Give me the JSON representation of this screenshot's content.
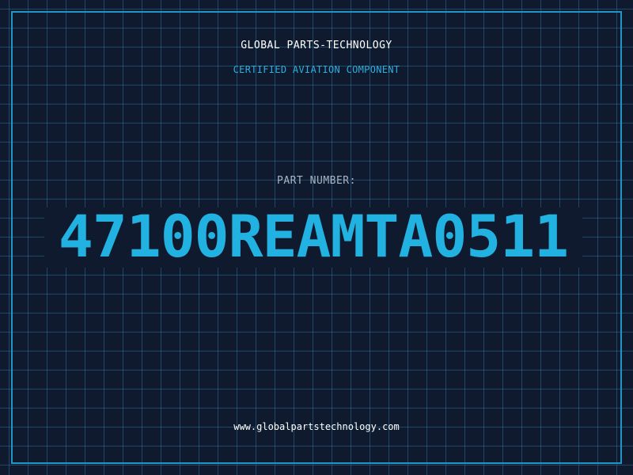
{
  "header": {
    "company": "GLOBAL PARTS-TECHNOLOGY",
    "subtitle": "CERTIFIED AVIATION COMPONENT"
  },
  "part": {
    "label": "PART NUMBER:",
    "number": "47100REAMTA0511"
  },
  "footer": {
    "website": "www.globalpartstechnology.com"
  },
  "colors": {
    "background": "#101a2e",
    "grid": "#286e96",
    "accent": "#22b2e2",
    "border": "#1f97c4"
  }
}
